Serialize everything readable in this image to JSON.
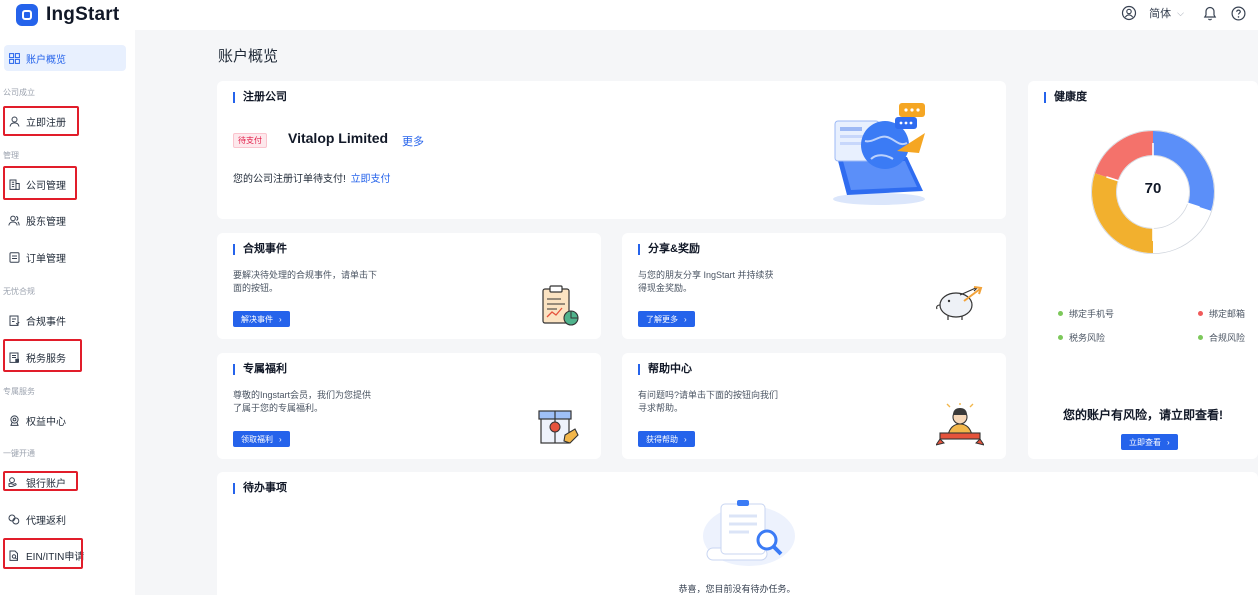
{
  "app": {
    "name": "IngStart"
  },
  "topbar": {
    "language": "简体"
  },
  "sidebar": {
    "items": [
      {
        "label": "账户概览"
      },
      {
        "group": "公司成立"
      },
      {
        "label": "立即注册"
      },
      {
        "group": "管理"
      },
      {
        "label": "公司管理"
      },
      {
        "label": "股东管理"
      },
      {
        "label": "订单管理"
      },
      {
        "group": "无忧合规"
      },
      {
        "label": "合规事件"
      },
      {
        "label": "税务服务"
      },
      {
        "group": "专属服务"
      },
      {
        "label": "权益中心"
      },
      {
        "group": "一键开通"
      },
      {
        "label": "银行账户"
      },
      {
        "label": "代理返利"
      },
      {
        "label": "EIN/ITIN申请"
      }
    ]
  },
  "page": {
    "title": "账户概览"
  },
  "register_card": {
    "title": "注册公司",
    "status_tag": "待支付",
    "company_name": "Vitalop Limited",
    "more_link": "更多",
    "notice": "您的公司注册订单待支付!",
    "pay_link": "立即支付"
  },
  "compliance_card": {
    "title": "合规事件",
    "desc_line1": "要解决待处理的合规事件，请单击下",
    "desc_line2": "面的按钮。",
    "button": "解决事件"
  },
  "share_card": {
    "title": "分享&奖励",
    "desc_line1": "与您的朋友分享 IngStart 并持续获",
    "desc_line2": "得现金奖励。",
    "button": "了解更多"
  },
  "benefit_card": {
    "title": "专属福利",
    "desc_line1": "尊敬的Ingstart会员，我们为您提供",
    "desc_line2": "了属于您的专属福利。",
    "button": "领取福利"
  },
  "help_card": {
    "title": "帮助中心",
    "desc_line1": "有问题吗?请单击下面的按钮向我们",
    "desc_line2": "寻求帮助。",
    "button": "获得帮助"
  },
  "health_card": {
    "title": "健康度",
    "score": "70",
    "legend": [
      {
        "label": "绑定手机号",
        "status": "ok"
      },
      {
        "label": "绑定邮箱",
        "status": "warn"
      },
      {
        "label": "税务风险",
        "status": "ok"
      },
      {
        "label": "合规风险",
        "status": "ok"
      }
    ],
    "risk_text": "您的账户有风险，请立即查看!",
    "button": "立即查看"
  },
  "todo_card": {
    "title": "待办事项",
    "empty_text": "恭喜，您目前没有待办任务。"
  },
  "colors": {
    "accent": "#2563eb",
    "highlight_box": "#e11d2a",
    "donut_blue": "#5b8ff9",
    "donut_red": "#f4726b",
    "donut_yellow": "#f2b02e",
    "dot_ok": "#7cc85a",
    "dot_warn": "#f05a5a"
  }
}
